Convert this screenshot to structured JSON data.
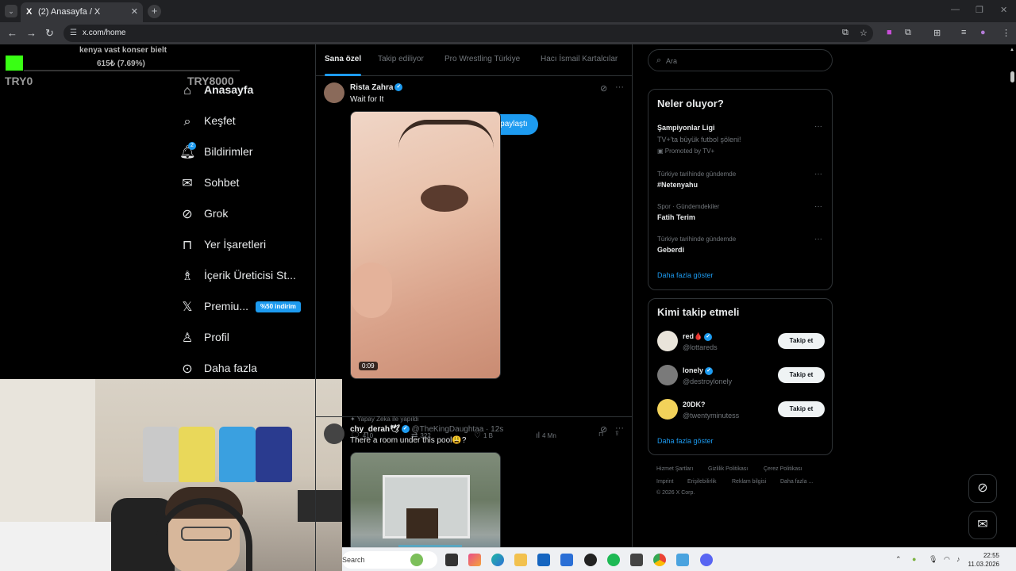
{
  "browser": {
    "tab_title": "(2) Anasayfa / X",
    "tab_icon": "X",
    "url": "x.com/home"
  },
  "overlay": {
    "concert_text": "kenya vast konser bielt",
    "price_text": "615₺ (7.69%)",
    "try_left": "TRY0",
    "try_right": "TRY8000",
    "accent_color": "#39ff14"
  },
  "nav": {
    "items": [
      {
        "label": "Anasayfa",
        "icon": "home-icon"
      },
      {
        "label": "Keşfet",
        "icon": "search-icon"
      },
      {
        "label": "Bildirimler",
        "icon": "bell-icon",
        "badge": "2"
      },
      {
        "label": "Sohbet",
        "icon": "mail-icon"
      },
      {
        "label": "Grok",
        "icon": "grok-icon"
      },
      {
        "label": "Yer İşaretleri",
        "icon": "bookmark-icon"
      },
      {
        "label": "İçerik Üreticisi St...",
        "icon": "creator-studio-icon"
      },
      {
        "label": "Premiu...",
        "icon": "x-logo-icon",
        "badge": "%50 indirim"
      },
      {
        "label": "Profil",
        "icon": "person-icon"
      },
      {
        "label": "Daha fazla",
        "icon": "more-circle-icon"
      }
    ]
  },
  "timeline": {
    "tabs": [
      "Sana özel",
      "Takip ediliyor",
      "Pro Wrestling Türkiye",
      "Hacı İsmail Kartalcılar"
    ],
    "share_pill": "gönderi paylaştı",
    "posts": [
      {
        "author": "Rista Zahra",
        "text": "Wait for It",
        "duration": "0:09",
        "ai_note": "Yapay Zeka ile yapıldı",
        "replies": "410",
        "reposts": "322",
        "likes": "1 B",
        "views": "4 Mn"
      },
      {
        "author": "chy_derah🕊",
        "handle": "@TheKingDaughtaa · 12s",
        "text": "There a room under this pool😩?"
      }
    ]
  },
  "sidebar": {
    "search_placeholder": "Ara",
    "trends_title": "Neler oluyor?",
    "trends": [
      {
        "name": "Şampiyonlar Ligi",
        "sub": "TV+'ta büyük futbol şöleni!",
        "meta": "Promoted by TV+"
      },
      {
        "meta": "Türkiye tarihinde gündemde",
        "name": "#Netenyahu"
      },
      {
        "meta": "Spor · Gündemdekiler",
        "name": "Fatih Terim"
      },
      {
        "meta": "Türkiye tarihinde gündemde",
        "name": "Geberdi"
      }
    ],
    "show_more": "Daha fazla göster",
    "follow_title": "Kimi takip etmeli",
    "who_to_follow": [
      {
        "name": "red🩸",
        "handle": "@lottareds",
        "button": "Takip et"
      },
      {
        "name": "lonely",
        "handle": "@destroylonely",
        "button": "Takip et"
      },
      {
        "name": "20DK?",
        "handle": "@twentyminutess",
        "button": "Takip et"
      }
    ],
    "footer_links": [
      "Hizmet Şartları",
      "Gizlilik Politikası",
      "Çerez Politikası",
      "Imprint",
      "Erişilebilirlik",
      "Reklam bilgisi",
      "Daha fazla ...",
      "© 2026 X Corp."
    ]
  },
  "taskbar": {
    "search_label": "Search",
    "time": "22:55",
    "date": "11.03.2026"
  }
}
